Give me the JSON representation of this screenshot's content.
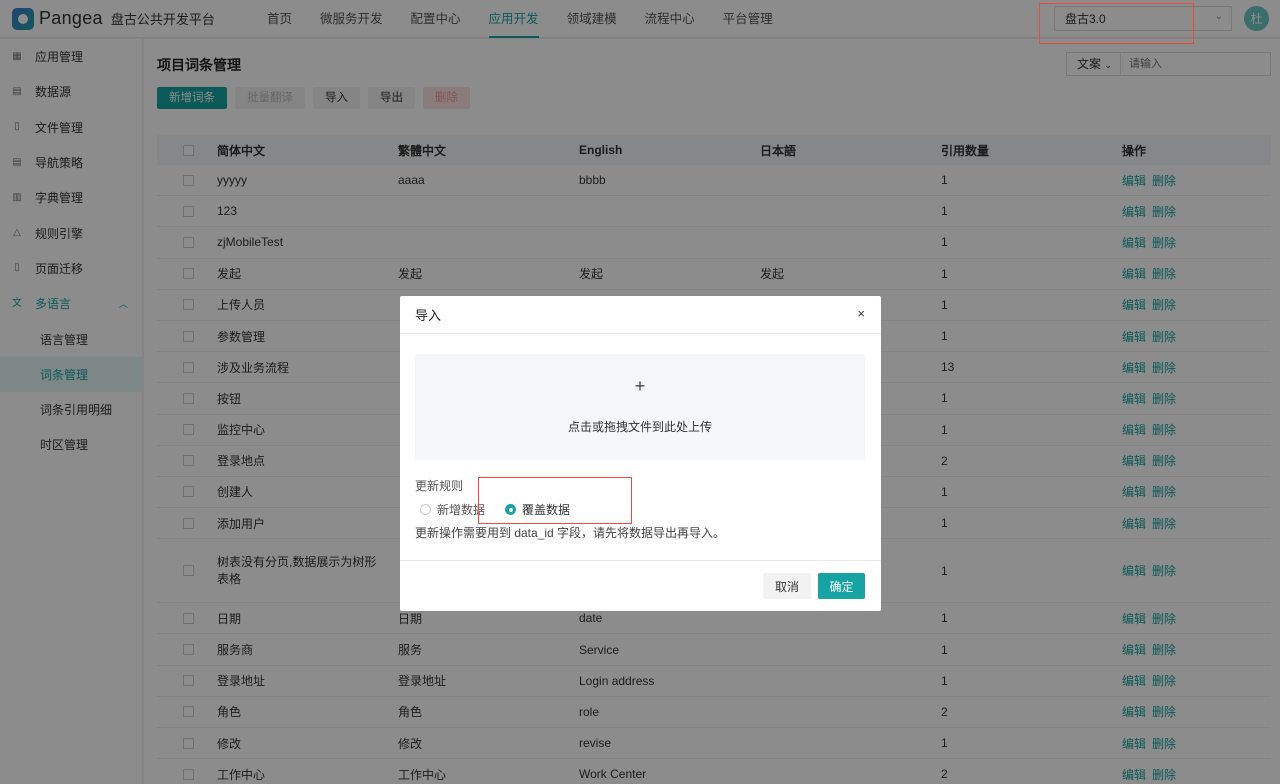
{
  "app": {
    "logo_text": "Pangea",
    "platform_name": "盘古公共开发平台"
  },
  "topnav": [
    {
      "label": "首页",
      "active": false
    },
    {
      "label": "微服务开发",
      "active": false
    },
    {
      "label": "配置中心",
      "active": false
    },
    {
      "label": "应用开发",
      "active": true
    },
    {
      "label": "领域建模",
      "active": false
    },
    {
      "label": "流程中心",
      "active": false
    },
    {
      "label": "平台管理",
      "active": false
    }
  ],
  "project_select": {
    "value": "盘古3.0"
  },
  "avatar": {
    "initial": "杜"
  },
  "sidebar": {
    "items": [
      {
        "label": "应用管理",
        "icon": "grid-icon"
      },
      {
        "label": "数据源",
        "icon": "list-icon"
      },
      {
        "label": "文件管理",
        "icon": "file-icon"
      },
      {
        "label": "导航策略",
        "icon": "list-icon"
      },
      {
        "label": "字典管理",
        "icon": "book-icon"
      },
      {
        "label": "规则引擎",
        "icon": "warning-icon"
      },
      {
        "label": "页面迁移",
        "icon": "file-icon"
      }
    ],
    "group": {
      "label": "多语言",
      "icon": "translate-icon"
    },
    "subitems": [
      {
        "label": "语言管理",
        "active": false
      },
      {
        "label": "词条管理",
        "active": true
      },
      {
        "label": "词条引用明细",
        "active": false
      },
      {
        "label": "时区管理",
        "active": false
      }
    ]
  },
  "main": {
    "title": "项目词条管理",
    "lang_select": "文案",
    "search_placeholder": "请输入",
    "toolbar": {
      "add": "新增词条",
      "batch_translate": "批量翻译",
      "import": "导入",
      "export": "导出",
      "delete": "删除"
    }
  },
  "table": {
    "headers": {
      "zh": "简体中文",
      "tw": "繁體中文",
      "en": "English",
      "ja": "日本語",
      "count": "引用数量",
      "op": "操作"
    },
    "op_edit": "编辑",
    "op_delete": "删除",
    "rows": [
      {
        "zh": "yyyyy",
        "tw": "aaaa",
        "en": "bbbb",
        "ja": "",
        "count": "1"
      },
      {
        "zh": "123",
        "tw": "",
        "en": "",
        "ja": "",
        "count": "1"
      },
      {
        "zh": "zjMobileTest",
        "tw": "",
        "en": "",
        "ja": "",
        "count": "1"
      },
      {
        "zh": "发起",
        "tw": "发起",
        "en": "发起",
        "ja": "发起",
        "count": "1"
      },
      {
        "zh": "上传人员",
        "tw": "",
        "en": "",
        "ja": "",
        "count": "1"
      },
      {
        "zh": "参数管理",
        "tw": "",
        "en": "",
        "ja": "",
        "count": "1"
      },
      {
        "zh": "涉及业务流程",
        "tw": "",
        "en": "",
        "ja": "",
        "count": "13"
      },
      {
        "zh": "按钮",
        "tw": "",
        "en": "",
        "ja": "",
        "count": "1"
      },
      {
        "zh": "监控中心",
        "tw": "",
        "en": "",
        "ja": "",
        "count": "1"
      },
      {
        "zh": "登录地点",
        "tw": "",
        "en": "",
        "ja": "",
        "count": "2"
      },
      {
        "zh": "创建人",
        "tw": "",
        "en": "",
        "ja": "",
        "count": "1"
      },
      {
        "zh": "添加用户",
        "tw": "",
        "en": "",
        "ja": "",
        "count": "1"
      },
      {
        "zh": "树表没有分页,数据展示为树形表格",
        "tw": "",
        "en": "",
        "ja": "",
        "count": "1"
      },
      {
        "zh": "日期",
        "tw": "日期",
        "en": "date",
        "ja": "",
        "count": "1"
      },
      {
        "zh": "服务商",
        "tw": "服务",
        "en": "Service",
        "ja": "",
        "count": "1"
      },
      {
        "zh": "登录地址",
        "tw": "登录地址",
        "en": "Login address",
        "ja": "",
        "count": "1"
      },
      {
        "zh": "角色",
        "tw": "角色",
        "en": "role",
        "ja": "",
        "count": "2"
      },
      {
        "zh": "修改",
        "tw": "修改",
        "en": "revise",
        "ja": "",
        "count": "1"
      },
      {
        "zh": "工作中心",
        "tw": "工作中心",
        "en": "Work Center",
        "ja": "",
        "count": "2"
      }
    ]
  },
  "modal": {
    "title": "导入",
    "close": "×",
    "dropzone_plus": "+",
    "dropzone_text": "点击或拖拽文件到此处上传",
    "rule_label": "更新规则",
    "options": [
      {
        "label": "新增数据",
        "checked": false
      },
      {
        "label": "覆盖数据",
        "checked": true
      }
    ],
    "note": "更新操作需要用到 data_id 字段，请先将数据导出再导入。",
    "cancel": "取消",
    "ok": "确定"
  },
  "colors": {
    "accent": "#17a2a3",
    "annotation": "#e74c3c"
  }
}
